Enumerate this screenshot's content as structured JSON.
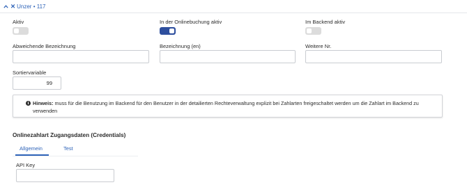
{
  "section": {
    "title": "Unzer • 117",
    "chevron_icon": "chevron-up-icon",
    "x_icon": "x-icon",
    "accent": "#2e63b8"
  },
  "fields": {
    "aktiv": {
      "label": "Aktiv",
      "checked": false
    },
    "online_aktiv": {
      "label": "In der Onlinebuchung aktiv",
      "checked": true
    },
    "backend_aktiv": {
      "label": "Im Backend aktiv",
      "checked": false
    },
    "abweichende_bezeichnung": {
      "label": "Abweichende Bezeichnung",
      "value": ""
    },
    "bezeichnung_en": {
      "label": "Bezeichnung (en)",
      "value": ""
    },
    "weitere_nr": {
      "label": "Weitere Nr.",
      "value": ""
    },
    "sortiervariable": {
      "label": "Sortiervariable",
      "value": "99"
    }
  },
  "notice": {
    "icon": "info-icon",
    "bold": "Hinweis:",
    "text": " muss für die Benutzung im Backend für den Benutzer in der detailierten Rechteverwaltung explizit bei Zahlarten freigeschaltet werden um die Zahlart im Backend zu verwenden"
  },
  "credentials": {
    "title": "Onlinezahlart Zugangsdaten (Credentials)",
    "tabs": [
      {
        "label": "Allgemein",
        "active": true
      },
      {
        "label": "Test",
        "active": false
      }
    ],
    "api_key": {
      "label": "API Key",
      "value": ""
    }
  },
  "colors": {
    "toggle_on": "#2e4f9e",
    "toggle_off": "#dcdcdc"
  }
}
